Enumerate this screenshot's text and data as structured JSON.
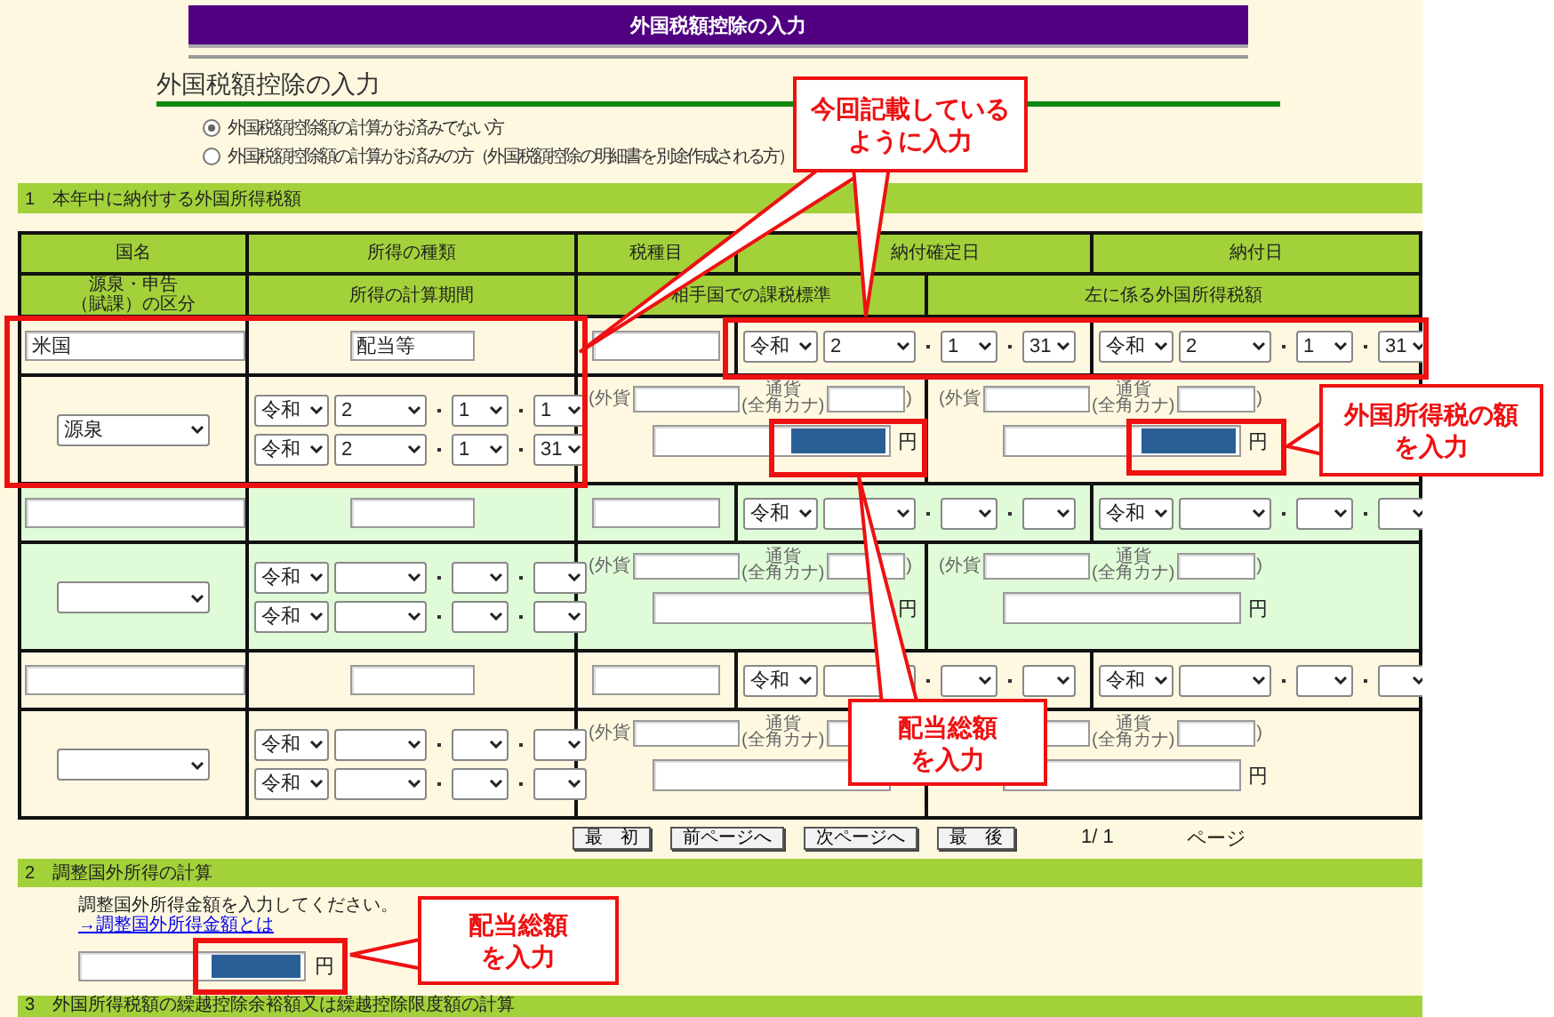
{
  "header": {
    "title": "外国税額控除の入力"
  },
  "subheading": "外国税額控除の入力",
  "calculation_options": [
    {
      "label": "外国税額控除額の計算がお済みでない方",
      "selected": true
    },
    {
      "label": "外国税額控除額の計算がお済みの方（外国税額控除の明細書を別途作成される方）",
      "selected": false
    }
  ],
  "section_1": {
    "title": "1　本年中に納付する外国所得税額",
    "header_row_1": [
      "国名",
      "所得の種類",
      "税種目",
      "納付確定日",
      "納付日"
    ],
    "header_row_2": [
      [
        "源泉・申告",
        "（賦課）の区分"
      ],
      [
        "所得の計算期間"
      ],
      [
        "相手国での課税標準"
      ],
      [
        "左に係る外国所得税額"
      ]
    ],
    "entries": [
      {
        "country": "米国",
        "income_type": "配当等",
        "determination_date": {
          "era": "令和",
          "year": "2",
          "month": "1",
          "day": "31"
        },
        "payment_date": {
          "era": "令和",
          "year": "2",
          "month": "1",
          "day": "31"
        },
        "classification": "源泉",
        "period_start": {
          "era": "令和",
          "year": "2",
          "month": "1",
          "day": "1"
        },
        "period_end": {
          "era": "令和",
          "year": "2",
          "month": "1",
          "day": "31"
        },
        "taxable_base": {
          "foreign_label": "(外貨",
          "currency_label": [
            "通貨",
            "(全角カナ)"
          ],
          "close": ")",
          "unit": "円",
          "redacted": true
        },
        "foreign_tax": {
          "foreign_label": "(外貨",
          "currency_label": [
            "通貨",
            "(全角カナ)"
          ],
          "close": ")",
          "unit": "円",
          "redacted": true
        }
      },
      {
        "determination_date": {
          "era": "令和"
        },
        "payment_date": {
          "era": "令和"
        },
        "period_start": {
          "era": "令和"
        },
        "period_end": {
          "era": "令和"
        },
        "taxable_base": {
          "foreign_label": "(外貨",
          "currency_label": [
            "通貨",
            "(全角カナ)"
          ],
          "close": ")",
          "unit": "円",
          "redacted": false
        },
        "foreign_tax": {
          "foreign_label": "(外貨",
          "currency_label": [
            "通貨",
            "(全角カナ)"
          ],
          "close": ")",
          "unit": "円",
          "redacted": false
        }
      },
      {
        "determination_date": {
          "era": "令和"
        },
        "payment_date": {
          "era": "令和"
        },
        "period_start": {
          "era": "令和"
        },
        "period_end": {
          "era": "令和"
        },
        "taxable_base": {
          "foreign_label": "(外貨",
          "currency_label": [
            "通貨",
            "(全角カナ)"
          ],
          "redacted": false
        },
        "foreign_tax": {
          "currency_label": [
            "通貨",
            "(全角カナ)"
          ],
          "close": ")",
          "unit": "円",
          "redacted": false
        }
      }
    ]
  },
  "pagination": {
    "buttons": [
      "最　初",
      "前ページへ",
      "次ページへ",
      "最　後"
    ],
    "page": "1/ 1",
    "unit": "ページ"
  },
  "section_2": {
    "title": "2　調整国外所得の計算",
    "instruction": "調整国外所得金額を入力してください。",
    "link": "→調整国外所得金額とは",
    "amount": {
      "redacted": true
    },
    "unit": "円"
  },
  "section_3": {
    "title": "3　外国所得税額の繰越控除余裕額又は繰越控除限度額の計算"
  },
  "callouts": [
    {
      "lines": [
        "今回記載している",
        "ように入力"
      ]
    },
    {
      "lines": [
        "外国所得税の額",
        "を入力"
      ]
    },
    {
      "lines": [
        "配当総額",
        "を入力"
      ]
    },
    {
      "lines": [
        "配当総額",
        "を入力"
      ]
    }
  ]
}
